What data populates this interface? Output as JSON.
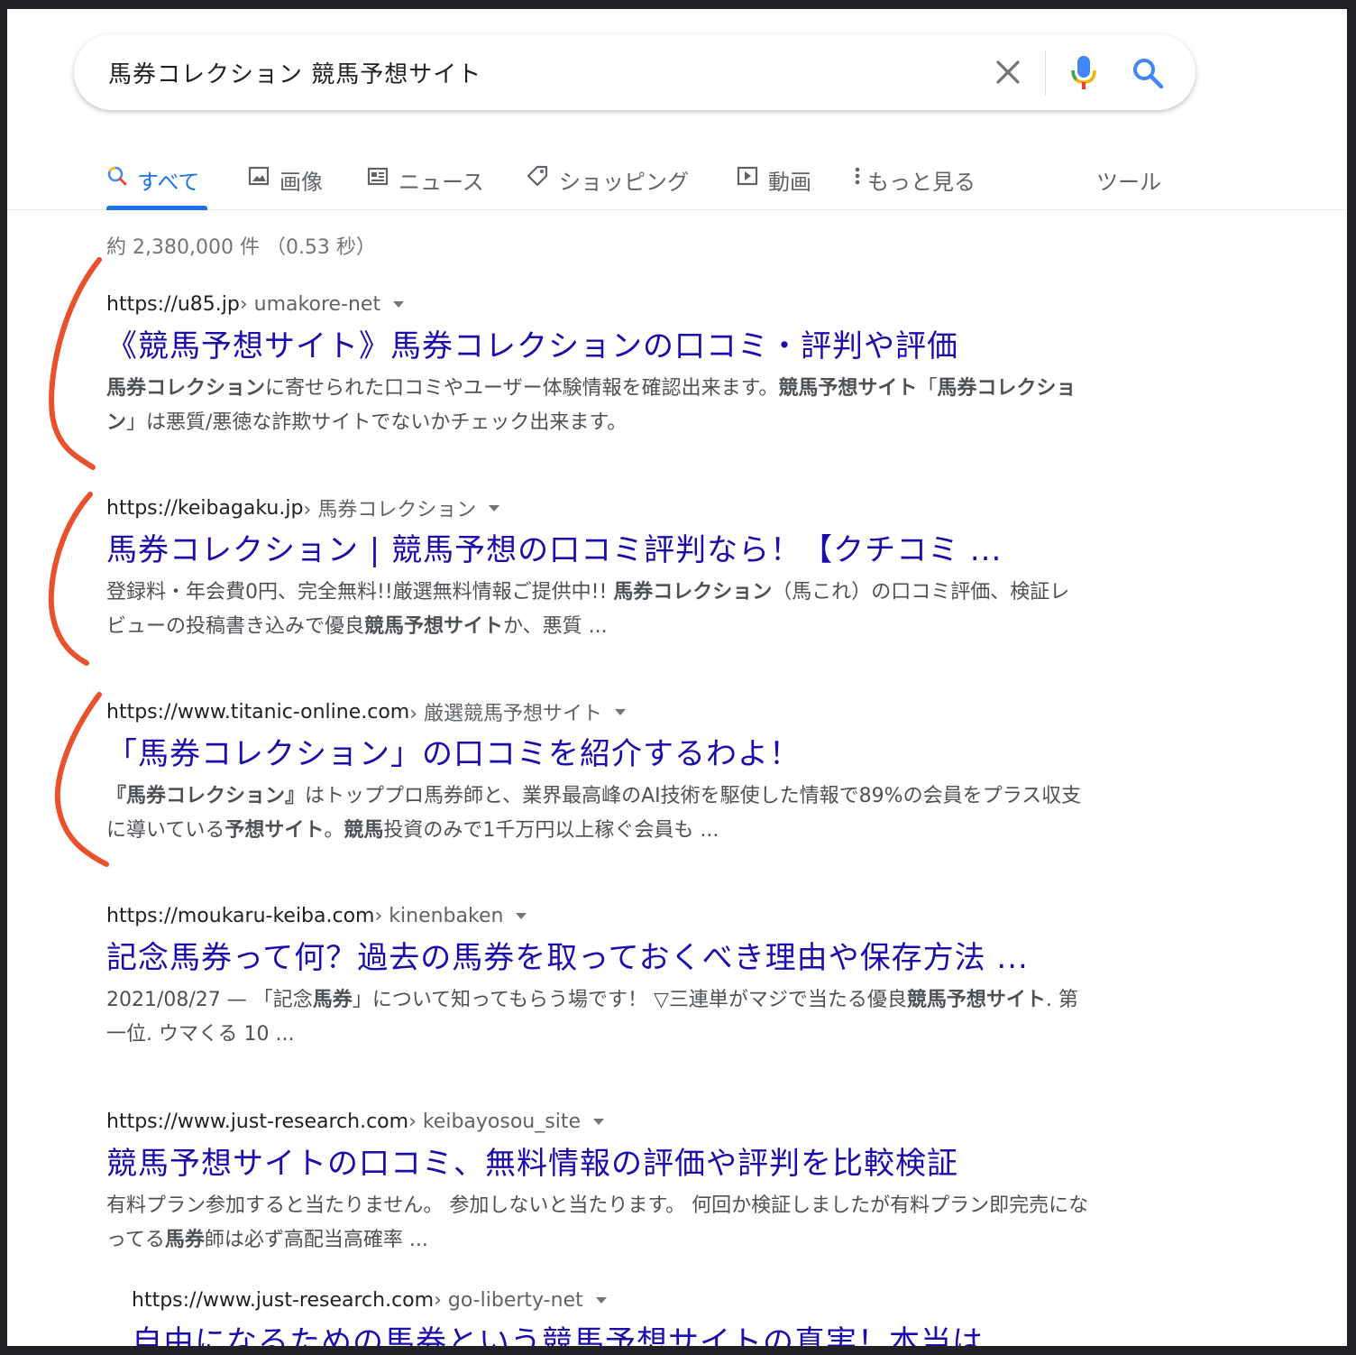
{
  "search": {
    "query": "馬券コレクション 競馬予想サイト"
  },
  "tabs": [
    {
      "label": "すべて",
      "icon": "search-icon",
      "active": true
    },
    {
      "label": "画像",
      "icon": "image-icon"
    },
    {
      "label": "ニュース",
      "icon": "news-icon"
    },
    {
      "label": "ショッピング",
      "icon": "tag-icon"
    },
    {
      "label": "動画",
      "icon": "play-icon"
    },
    {
      "label": "もっと見る",
      "icon": "more-vertical-icon"
    },
    {
      "label": "ツール"
    }
  ],
  "stats": "約 2,380,000 件 （0.53 秒）",
  "results": [
    {
      "site": "https://u85.jp",
      "path": " › umakore-net",
      "title": "《競馬予想サイト》馬券コレクションの口コミ・評判や評価",
      "snippet": [
        {
          "b": "馬券コレクション"
        },
        {
          "t": "に寄せられた口コミやユーザー体験情報を確認出来ます。"
        },
        {
          "b": "競馬予想サイト"
        },
        {
          "t": "「"
        },
        {
          "b": "馬券コレクション"
        },
        {
          "t": "」は悪質/悪徳な詐欺サイトでないかチェック出来ます。"
        }
      ]
    },
    {
      "site": "https://keibagaku.jp",
      "path": " › 馬券コレクション",
      "title": "馬券コレクション | 競馬予想の口コミ評判なら！【クチコミ ...",
      "snippet": [
        {
          "t": "登録料・年会費0円、完全無料!!厳選無料情報ご提供中!! "
        },
        {
          "b": "馬券コレクション"
        },
        {
          "t": "（馬これ）の口コミ評価、検証レビューの投稿書き込みで優良"
        },
        {
          "b": "競馬予想サイト"
        },
        {
          "t": "か、悪質 ..."
        }
      ]
    },
    {
      "site": "https://www.titanic-online.com",
      "path": " › 厳選競馬予想サイト",
      "title": "「馬券コレクション」の口コミを紹介するわよ！",
      "snippet": [
        {
          "b": "『馬券コレクション』"
        },
        {
          "t": "はトッププロ馬券師と、業界最高峰のAI技術を駆使した情報で89%の会員をプラス収支に導いている"
        },
        {
          "b": "予想サイト"
        },
        {
          "t": "。"
        },
        {
          "b": "競馬"
        },
        {
          "t": "投資のみで1千万円以上稼ぐ会員も ..."
        }
      ]
    },
    {
      "site": "https://moukaru-keiba.com",
      "path": " › kinenbaken",
      "title": "記念馬券って何？過去の馬券を取っておくべき理由や保存方法 ...",
      "snippet": [
        {
          "t": "2021/08/27 — 「記念"
        },
        {
          "b": "馬券"
        },
        {
          "t": "」について知ってもらう場です！ ▽三連単がマジで当たる優良"
        },
        {
          "b": "競馬予想サイト"
        },
        {
          "t": ". 第一位. ウマくる 10 ..."
        }
      ]
    },
    {
      "site": "https://www.just-research.com",
      "path": " › keibayosou_site",
      "title": "競馬予想サイトの口コミ、無料情報の評価や評判を比較検証",
      "snippet": [
        {
          "t": "有料プラン参加すると当たりません。 参加しないと当たります。 何回か検証しましたが有料プラン即完売になってる"
        },
        {
          "b": "馬券"
        },
        {
          "t": "師は必ず高配当高確率 ..."
        }
      ]
    },
    {
      "site": "https://www.just-research.com",
      "path": " › go-liberty-net",
      "title": "自由になるための馬券という競馬予想サイトの真実！本当は ...",
      "snippet": []
    }
  ],
  "colors": {
    "link": "#1a0dab",
    "accent": "#1a73e8",
    "annotation": "#e8512c"
  }
}
